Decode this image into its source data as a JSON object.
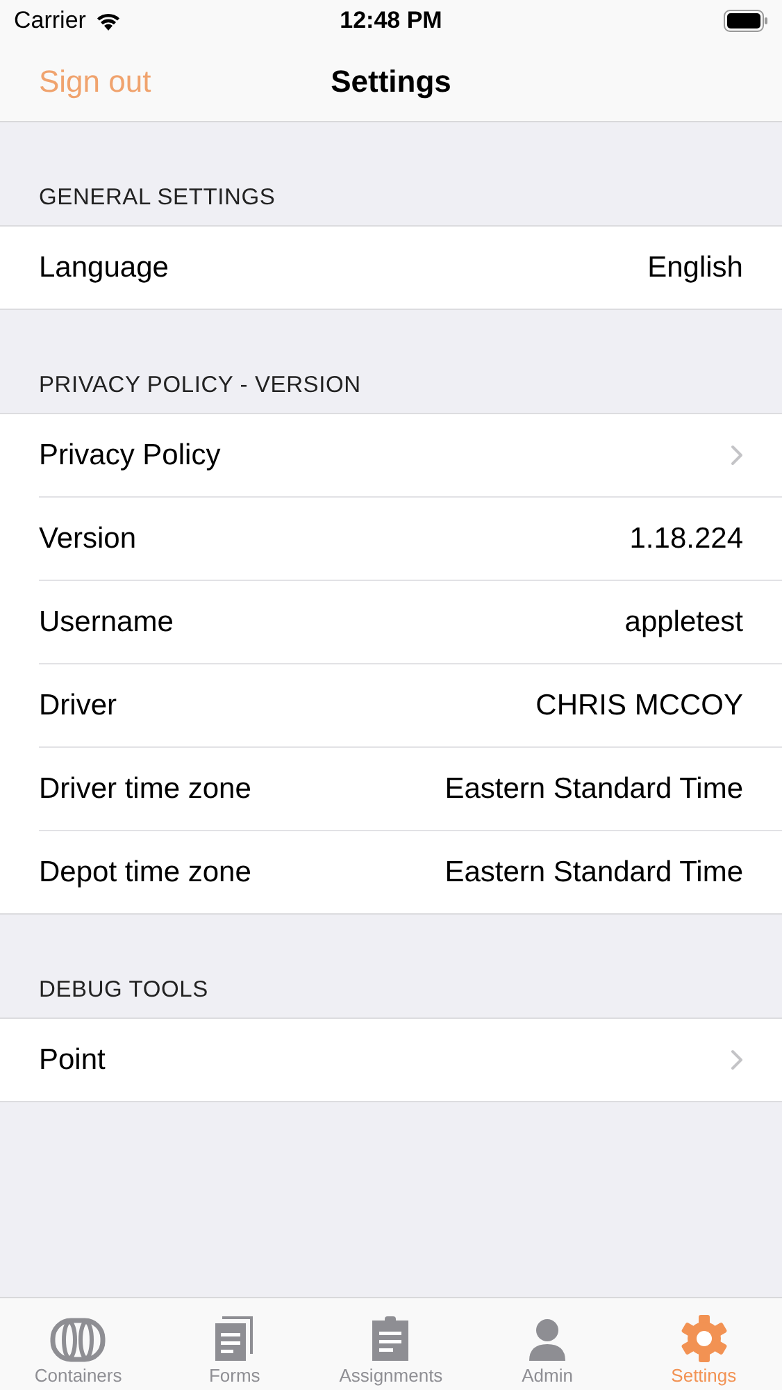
{
  "status_bar": {
    "carrier": "Carrier",
    "time": "12:48 PM"
  },
  "nav": {
    "left_button": "Sign out",
    "title": "Settings"
  },
  "sections": [
    {
      "header": "GENERAL SETTINGS",
      "rows": [
        {
          "kind": "value",
          "label": "Language",
          "value": "English"
        }
      ]
    },
    {
      "header": "PRIVACY POLICY - VERSION",
      "rows": [
        {
          "kind": "link",
          "label": "Privacy Policy"
        },
        {
          "kind": "value",
          "label": "Version",
          "value": "1.18.224"
        },
        {
          "kind": "value",
          "label": "Username",
          "value": "appletest"
        },
        {
          "kind": "value",
          "label": "Driver",
          "value": "CHRIS MCCOY"
        },
        {
          "kind": "value",
          "label": "Driver time zone",
          "value": "Eastern Standard Time"
        },
        {
          "kind": "value",
          "label": "Depot time zone",
          "value": "Eastern Standard Time"
        }
      ]
    },
    {
      "header": "DEBUG TOOLS",
      "rows": [
        {
          "kind": "link",
          "label": "Point"
        }
      ]
    }
  ],
  "tabs": [
    {
      "label": "Containers",
      "selected": false
    },
    {
      "label": "Forms",
      "selected": false
    },
    {
      "label": "Assignments",
      "selected": false
    },
    {
      "label": "Admin",
      "selected": false
    },
    {
      "label": "Settings",
      "selected": true
    }
  ]
}
